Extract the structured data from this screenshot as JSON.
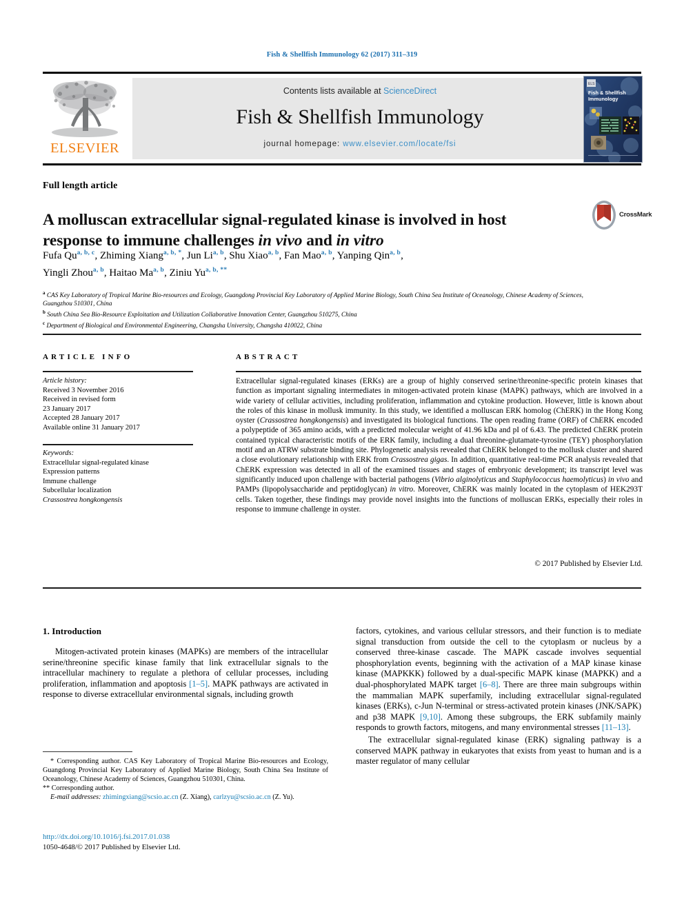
{
  "running_head": "Fish & Shellfish Immunology 62 (2017) 311–319",
  "masthead": {
    "contents_prefix": "Contents lists available at ",
    "sciencedirect": "ScienceDirect",
    "journal_title": "Fish & Shellfish Immunology",
    "homepage_prefix": "journal homepage: ",
    "homepage_url": "www.elsevier.com/locate/fsi",
    "publisher": "ELSEVIER",
    "cover_title_line1": "Fish & Shellfish",
    "cover_title_line2": "Immunology"
  },
  "article_type": "Full length article",
  "title_line1": "A molluscan extracellular signal-regulated kinase is involved in host",
  "title_line2_a": "response to immune challenges ",
  "title_line2_in_vivo": "in vivo",
  "title_line2_b": " and ",
  "title_line2_in_vitro": "in vitro",
  "crossmark_label": "CrossMark",
  "authors": [
    {
      "name": "Fufa Qu",
      "sup": "a, b, c",
      "sep": ", "
    },
    {
      "name": "Zhiming Xiang",
      "sup": "a, b, *",
      "sep": ", "
    },
    {
      "name": "Jun Li",
      "sup": "a, b",
      "sep": ", "
    },
    {
      "name": "Shu Xiao",
      "sup": "a, b",
      "sep": ", "
    },
    {
      "name": "Fan Mao",
      "sup": "a, b",
      "sep": ", "
    },
    {
      "name": "Yanping Qin",
      "sup": "a, b",
      "sep": ", "
    },
    {
      "name": "Yingli Zhou",
      "sup": "a, b",
      "sep": ", "
    },
    {
      "name": "Haitao Ma",
      "sup": "a, b",
      "sep": ", "
    },
    {
      "name": "Ziniu Yu",
      "sup": "a, b, **",
      "sep": ""
    }
  ],
  "affiliations": [
    {
      "marker": "a",
      "text": "CAS Key Laboratory of Tropical Marine Bio-resources and Ecology, Guangdong Provincial Key Laboratory of Applied Marine Biology, South China Sea Institute of Oceanology, Chinese Academy of Sciences, Guangzhou 510301, China"
    },
    {
      "marker": "b",
      "text": "South China Sea Bio-Resource Exploitation and Utilization Collaborative Innovation Center, Guangzhou 510275, China"
    },
    {
      "marker": "c",
      "text": "Department of Biological and Environmental Engineering, Changsha University, Changsha 410022, China"
    }
  ],
  "article_info_heading": "ARTICLE INFO",
  "abstract_heading": "ABSTRACT",
  "history": {
    "label": "Article history:",
    "lines": [
      "Received 3 November 2016",
      "Received in revised form",
      "23 January 2017",
      "Accepted 28 January 2017",
      "Available online 31 January 2017"
    ]
  },
  "keywords": {
    "label": "Keywords:",
    "items": [
      "Extracellular signal-regulated kinase",
      "Expression patterns",
      "Immune challenge",
      "Subcellular localization"
    ],
    "italic_item": "Crassostrea hongkongensis"
  },
  "abstract": {
    "p1": "Extracellular signal-regulated kinases (ERKs) are a group of highly conserved serine/threonine-specific protein kinases that function as important signaling intermediates in mitogen-activated protein kinase (MAPK) pathways, which are involved in a wide variety of cellular activities, including proliferation, inflammation and cytokine production. However, little is known about the roles of this kinase in mollusk immunity. In this study, we identified a molluscan ERK homolog (ChERK) in the Hong Kong oyster (",
    "sp1": "Crassostrea hongkongensis",
    "p2": ") and investigated its biological functions. The open reading frame (ORF) of ChERK encoded a polypeptide of 365 amino acids, with a predicted molecular weight of 41.96 kDa and pI of 6.43. The predicted ChERK protein contained typical characteristic motifs of the ERK family, including a dual threonine-glutamate-tyrosine (TEY) phosphorylation motif and an ATRW substrate binding site. Phylogenetic analysis revealed that ChERK belonged to the mollusk cluster and shared a close evolutionary relationship with ERK from ",
    "sp2": "Crassostrea gigas",
    "p3": ". In addition, quantitative real-time PCR analysis revealed that ChERK expression was detected in all of the examined tissues and stages of embryonic development; its transcript level was significantly induced upon challenge with bacterial pathogens (",
    "sp3": "Vibrio alginolyticus",
    "p4": " and ",
    "sp4": "Staphylococcus haemolyticus",
    "p5": ") ",
    "sp5": "in vivo",
    "p6": " and PAMPs (lipopolysaccharide and peptidoglycan) ",
    "sp6": "in vitro",
    "p7": ". Moreover, ChERK was mainly located in the cytoplasm of HEK293T cells. Taken together, these findings may provide novel insights into the functions of molluscan ERKs, especially their roles in response to immune challenge in oyster.",
    "copyright": "© 2017 Published by Elsevier Ltd."
  },
  "introduction": {
    "heading": "1. Introduction",
    "left_p1_a": "Mitogen-activated protein kinases (MAPKs) are members of the intracellular serine/threonine specific kinase family that link extracellular signals to the intracellular machinery to regulate a plethora of cellular processes, including proliferation, inflammation and apoptosis ",
    "left_p1_ref": "[1–5]",
    "left_p1_b": ". MAPK pathways are activated in response to diverse extracellular environmental signals, including growth",
    "right_p1_a": "factors, cytokines, and various cellular stressors, and their function is to mediate signal transduction from outside the cell to the cytoplasm or nucleus by a conserved three-kinase cascade. The MAPK cascade involves sequential phosphorylation events, beginning with the activation of a MAP kinase kinase kinase (MAPKKK) followed by a dual-specific MAPK kinase (MAPKK) and a dual-phosphorylated MAPK target ",
    "right_p1_ref1": "[6–8]",
    "right_p1_b": ". There are three main subgroups within the mammalian MAPK superfamily, including extracellular signal-regulated kinases (ERKs), c-Jun N-terminal or stress-activated protein kinases (JNK/SAPK) and p38 MAPK ",
    "right_p1_ref2": "[9,10]",
    "right_p1_c": ". Among these subgroups, the ERK subfamily mainly responds to growth factors, mitogens, and many environmental stresses ",
    "right_p1_ref3": "[11–13]",
    "right_p1_d": ".",
    "right_p2": "The extracellular signal-regulated kinase (ERK) signaling pathway is a conserved MAPK pathway in eukaryotes that exists from yeast to human and is a master regulator of many cellular"
  },
  "footnotes": {
    "star_marker": "*",
    "star_text": " Corresponding author. CAS Key Laboratory of Tropical Marine Bio-resources and Ecology, Guangdong Provincial Key Laboratory of Applied Marine Biology, South China Sea Institute of Oceanology, Chinese Academy of Sciences, Guangzhou 510301, China.",
    "dstar_marker": "**",
    "dstar_text": " Corresponding author.",
    "email_label": "E-mail addresses:",
    "email1": "zhimingxiang@scsio.ac.cn",
    "email1_owner": " (Z. Xiang), ",
    "email2": "carlzyu@scsio.ac.cn",
    "email2_owner": " (Z. Yu)."
  },
  "doi": {
    "url": "http://dx.doi.org/10.1016/j.fsi.2017.01.038",
    "issn_line": "1050-4648/© 2017 Published by Elsevier Ltd."
  },
  "colors": {
    "link_blue": "#1a7fb5",
    "sciencedirect_blue": "#3b8fc7",
    "elsevier_orange": "#f07f13",
    "sup_blue": "#2b7cb5",
    "band_gray": "#e7e7e7"
  }
}
